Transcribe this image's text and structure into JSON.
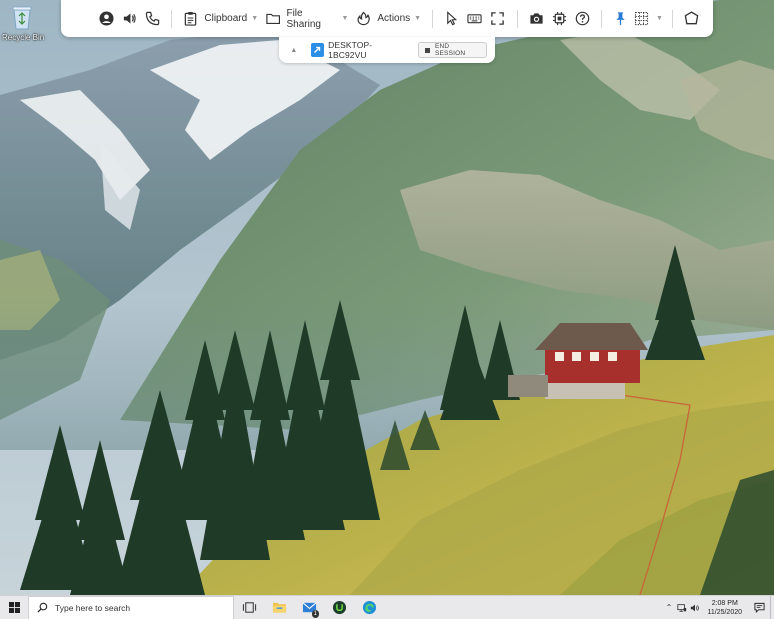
{
  "desktop": {
    "icons": [
      {
        "label": "Recycle Bin",
        "icon": "recycle-bin-icon"
      }
    ]
  },
  "toolbar": {
    "icons_left": [
      "user-icon",
      "speaker-icon",
      "phone-icon"
    ],
    "clipboard_label": "Clipboard",
    "file_sharing_label": "File Sharing",
    "actions_label": "Actions",
    "icons_right": [
      "pointer-icon",
      "keyboard-icon",
      "fullscreen-icon",
      "camera-icon",
      "chip-icon",
      "help-icon",
      "pin-icon",
      "grid-icon",
      "hexagon-icon"
    ],
    "pin_color": "#2a7ad8"
  },
  "session": {
    "machine_name": "DESKTOP-1BC92VU",
    "end_session_label": "END SESSION"
  },
  "taskbar": {
    "search_placeholder": "Type here to search",
    "pinned_apps": [
      "task-view-icon",
      "file-explorer-icon",
      "mail-icon",
      "upwork-icon",
      "edge-icon"
    ],
    "mail_badge": "1",
    "clock_time": "2:08 PM",
    "clock_date": "11/25/2020"
  }
}
